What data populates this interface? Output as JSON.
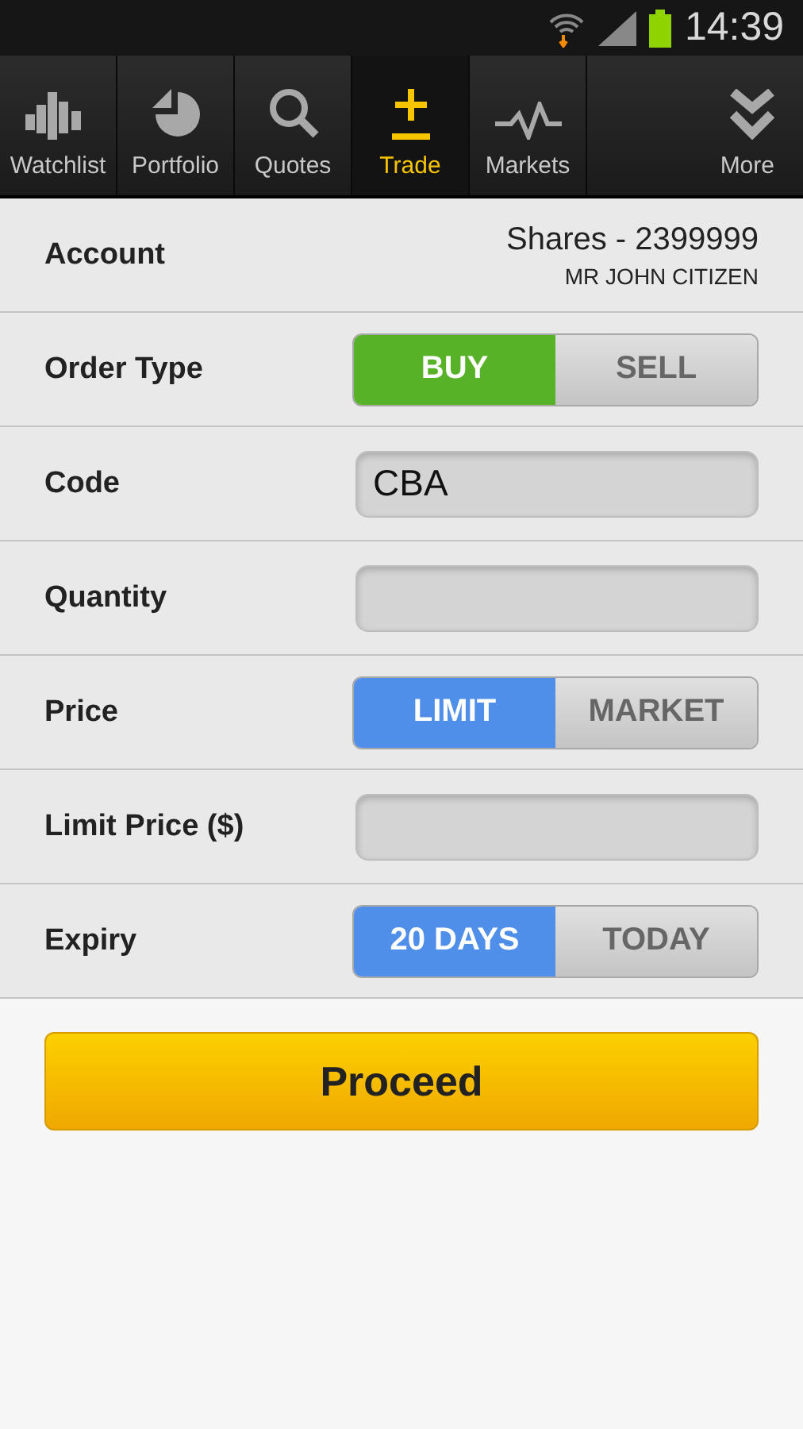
{
  "status_bar": {
    "time": "14:39"
  },
  "tabs": [
    {
      "label": "Watchlist",
      "selected": false
    },
    {
      "label": "Portfolio",
      "selected": false
    },
    {
      "label": "Quotes",
      "selected": false
    },
    {
      "label": "Trade",
      "selected": true
    },
    {
      "label": "Markets",
      "selected": false
    },
    {
      "label": "More",
      "selected": false
    }
  ],
  "form": [
    {
      "kind": "account",
      "label": "Account",
      "value": "Shares - 2399999",
      "subvalue": "MR JOHN CITIZEN"
    },
    {
      "kind": "toggle",
      "label": "Order Type",
      "color": "#58b228",
      "options": [
        {
          "label": "BUY",
          "selected": true
        },
        {
          "label": "SELL",
          "selected": false
        }
      ]
    },
    {
      "kind": "field",
      "label": "Code",
      "value": "CBA"
    },
    {
      "kind": "field",
      "label": "Quantity"
    },
    {
      "kind": "toggle",
      "label": "Price",
      "color": "#4f8fea",
      "options": [
        {
          "label": "LIMIT",
          "selected": true
        },
        {
          "label": "MARKET",
          "selected": false
        }
      ]
    },
    {
      "kind": "field",
      "label": "Limit Price ($)"
    },
    {
      "kind": "toggle",
      "label": "Expiry",
      "color": "#4f8fea",
      "options": [
        {
          "label": "20 DAYS",
          "selected": true
        },
        {
          "label": "TODAY",
          "selected": false
        }
      ]
    }
  ],
  "proceed_button": "Proceed"
}
